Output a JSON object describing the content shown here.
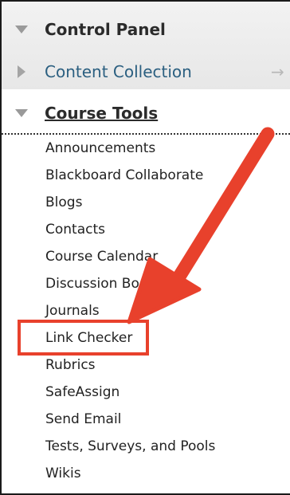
{
  "control_panel": {
    "title": "Control Panel",
    "content_collection": "Content Collection",
    "arrow_glyph": "→"
  },
  "course_tools": {
    "title": "Course Tools",
    "items": [
      "Announcements",
      "Blackboard Collaborate",
      "Blogs",
      "Contacts",
      "Course Calendar",
      "Discussion Boards",
      "Journals",
      "Link Checker",
      "Rubrics",
      "SafeAssign",
      "Send Email",
      "Tests, Surveys, and Pools",
      "Wikis"
    ],
    "highlighted_item": "Link Checker"
  },
  "annotation": {
    "color": "#e8412c"
  }
}
